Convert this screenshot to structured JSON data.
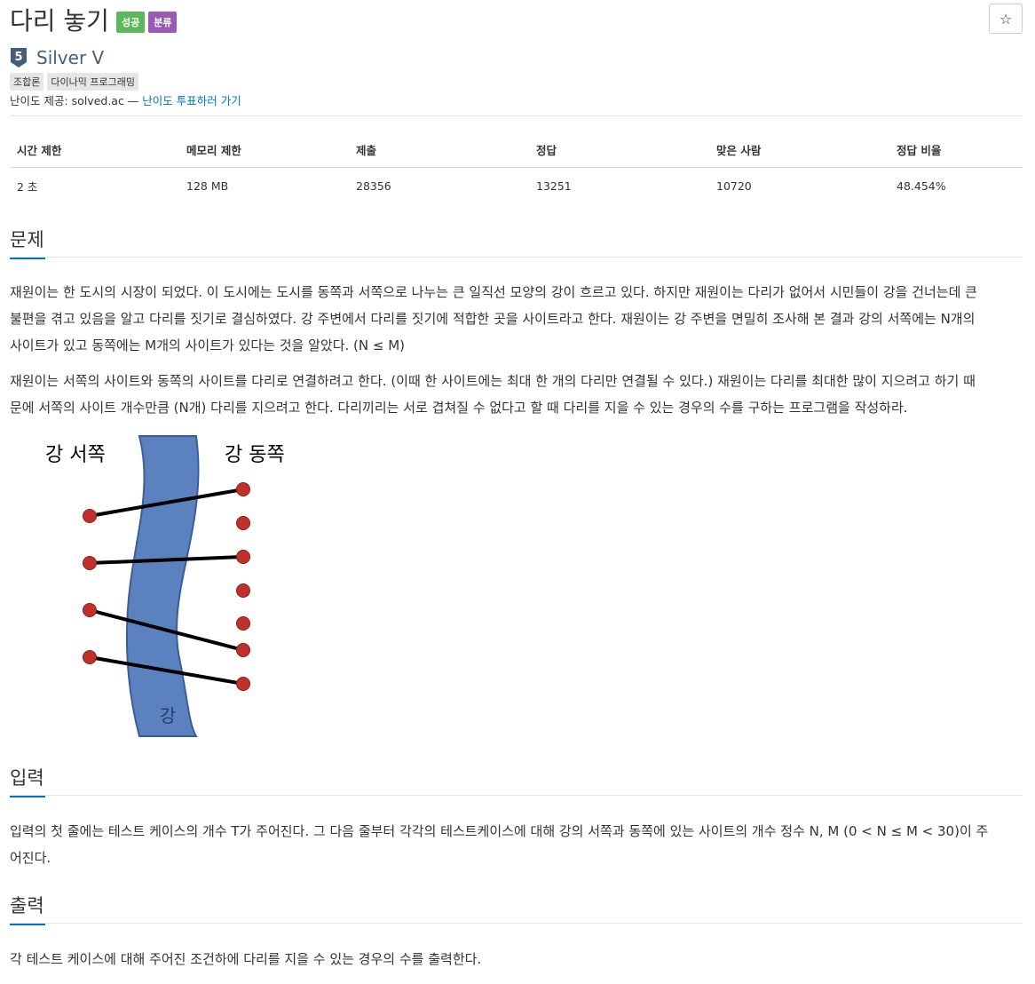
{
  "header": {
    "title": "다리 놓기",
    "badge_success": "성공",
    "badge_class": "분류",
    "star_icon": "star-outline-icon"
  },
  "tier": {
    "number": "5",
    "name": "Silver V",
    "color": "#435f7a"
  },
  "tags": [
    "조합론",
    "다이나믹 프로그래밍"
  ],
  "provider": {
    "prefix": "난이도 제공: solved.ac —",
    "link": "난이도 투표하러 가기"
  },
  "stats": {
    "headers": [
      "시간 제한",
      "메모리 제한",
      "제출",
      "정답",
      "맞은 사람",
      "정답 비율"
    ],
    "values": [
      "2 초",
      "128 MB",
      "28356",
      "13251",
      "10720",
      "48.454%"
    ]
  },
  "problem": {
    "heading": "문제",
    "lines1": [
      "재원이는 한 도시의 시장이 되었다. 이 도시에는 도시를 동쪽과 서쪽으로 나누는 큰 일직선 모양의 강이 흐르고 있다. 하지만 재원이는 다리가 없어서 시민들이 강을 건너는데 큰",
      "불편을 겪고 있음을 알고 다리를 짓기로 결심하였다. 강 주변에서 다리를 짓기에 적합한 곳을 사이트라고 한다. 재원이는 강 주변을 면밀히 조사해 본 결과 강의 서쪽에는 N개의",
      "사이트가 있고 동쪽에는 M개의 사이트가 있다는 것을 알았다. (N ≤ M)"
    ],
    "lines2": [
      "재원이는 서쪽의 사이트와 동쪽의 사이트를 다리로 연결하려고 한다. (이때 한 사이트에는 최대 한 개의 다리만 연결될 수 있다.) 재원이는 다리를 최대한 많이 지으려고 하기 때",
      "문에 서쪽의 사이트 개수만큼 (N개) 다리를 지으려고 한다. 다리끼리는 서로 겹쳐질 수 없다고 할 때 다리를 지을 수 있는 경우의 수를 구하는 프로그램을 작성하라."
    ],
    "figure": {
      "west_label": "강 서쪽",
      "east_label": "강 동쪽",
      "river_label": "강"
    }
  },
  "input": {
    "heading": "입력",
    "lines": [
      "입력의 첫 줄에는 테스트 케이스의 개수 T가 주어진다. 그 다음 줄부터 각각의 테스트케이스에 대해 강의 서쪽과 동쪽에 있는 사이트의 개수 정수 N, M (0 < N ≤ M < 30)이 주",
      "어진다."
    ]
  },
  "output": {
    "heading": "출력",
    "lines": [
      "각 테스트 케이스에 대해 주어진 조건하에 다리를 지을 수 있는 경우의 수를 출력한다."
    ]
  },
  "colors": {
    "accent": "#0076c0",
    "success": "#5cb85c",
    "class": "#9b59b6",
    "river": "#5b82bf",
    "site": "#c0312b"
  }
}
